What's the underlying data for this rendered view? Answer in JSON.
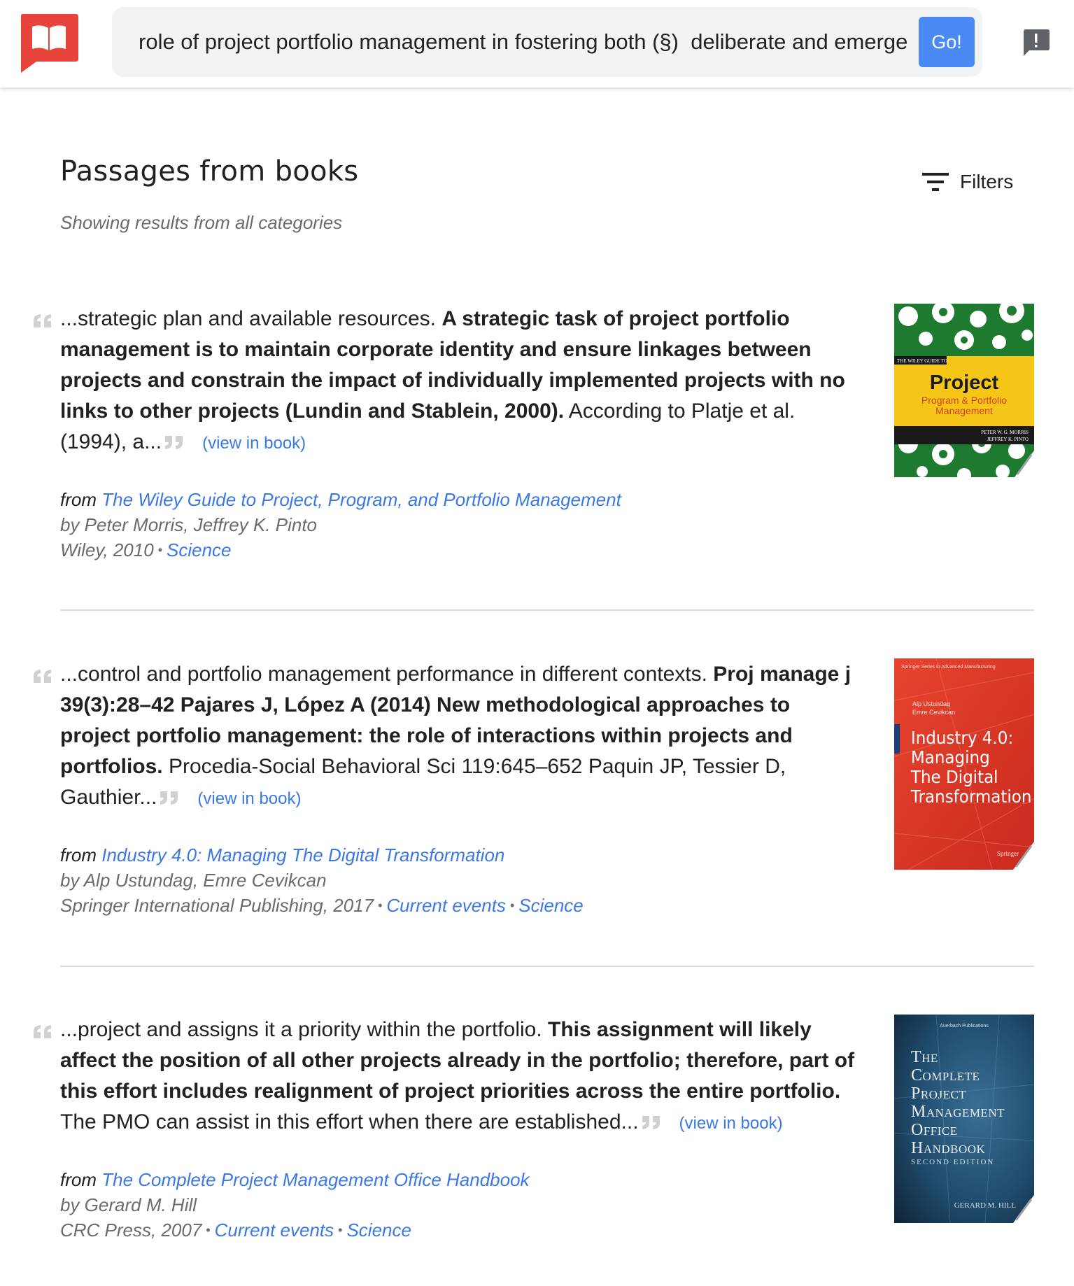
{
  "search": {
    "query": "role of project portfolio management in fostering both (§)  deliberate and emergent strategy",
    "go_label": "Go!"
  },
  "header": {
    "title": "Passages from books",
    "subtitle": "Showing results from all categories",
    "filters_label": "Filters"
  },
  "results": [
    {
      "pre": "...strategic plan and available resources. ",
      "bold": "A strategic task of project portfolio management is to maintain corporate identity and ensure linkages between projects and constrain the impact of individually implemented projects with no links to other projects (Lundin and Stablein, 2000).",
      "post": " According to Platje et al. (1994), a...",
      "view_label": "(view in book)",
      "from_label": "from",
      "book_title": "The Wiley Guide to Project, Program, and Portfolio Management",
      "authors": "by Peter Morris, Jeffrey K. Pinto",
      "publisher": "Wiley, 2010",
      "categories": [
        "Science"
      ],
      "cover": {
        "series": "THE WILEY GUIDE TO",
        "title": "Project",
        "subtitle": "Program & Portfolio Management",
        "author1": "PETER W. G. MORRIS",
        "author2": "JEFFREY K. PINTO",
        "green": "#1e7a2e",
        "yellow": "#f5c518"
      }
    },
    {
      "pre": "...control and portfolio management performance in different contexts. ",
      "bold": "Proj manage j 39(3):28–42 Pajares J, López A (2014) New methodological approaches to project portfolio management: the role of interactions within projects and portfolios.",
      "post": " Procedia-Social Behavioral Sci 119:645–652 Paquin JP, Tessier D, Gauthier...",
      "view_label": "(view in book)",
      "from_label": "from",
      "book_title": "Industry 4.0: Managing The Digital Transformation",
      "authors": "by Alp Ustundag, Emre Cevikcan",
      "publisher": "Springer International Publishing, 2017",
      "categories": [
        "Current events",
        "Science"
      ],
      "cover": {
        "series": "Springer Series in Advanced Manufacturing",
        "author1": "Alp Ustundag",
        "author2": "Emre Cevikcan",
        "line1": "Industry 4.0:",
        "line2": "Managing",
        "line3": "The Digital",
        "line4": "Transformation",
        "publisher_mark": "Springer",
        "red": "#e2372a"
      }
    },
    {
      "pre": "...project and assigns it a priority within the portfolio. ",
      "bold": "This assignment will likely affect the position of all other projects already in the portfolio; therefore, part of this effort includes realignment of project priorities across the entire portfolio.",
      "post": " The PMO can assist in this effort when there are established...",
      "view_label": "(view in book)",
      "from_label": "from",
      "book_title": "The Complete Project Management Office Handbook",
      "authors": "by Gerard M. Hill",
      "publisher": "CRC Press, 2007",
      "categories": [
        "Current events",
        "Science"
      ],
      "cover": {
        "series": "Auerbach Publications",
        "line1": "The",
        "line2": "Complete",
        "line3": "Project",
        "line4": "Management",
        "line5": "Office",
        "line6": "Handbook",
        "edition": "SECOND EDITION",
        "author": "GERARD M. HILL",
        "blue": "#1f4a6b"
      }
    }
  ],
  "colors": {
    "accent": "#4a8af4",
    "link": "#3b78e7",
    "logo_red": "#e8433a"
  }
}
